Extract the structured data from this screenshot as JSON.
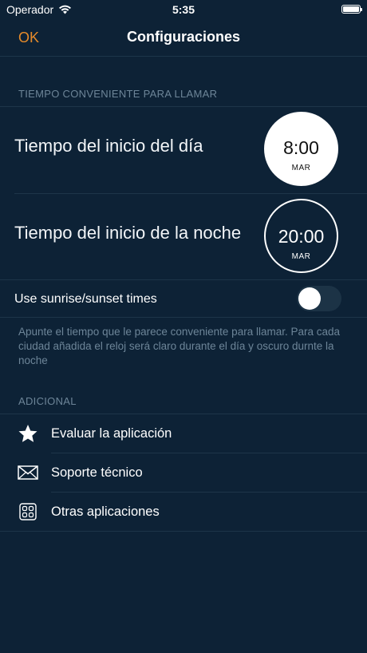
{
  "status_bar": {
    "carrier": "Operador",
    "time": "5:35"
  },
  "nav": {
    "ok_label": "OK",
    "title": "Configuraciones"
  },
  "convenient_time": {
    "header": "TIEMPO CONVENIENTE PARA LLAMAR",
    "day_label": "Tiempo del inicio del día",
    "day_time": "8:00",
    "day_weekday": "MAR",
    "night_label": "Tiempo del inicio de la noche",
    "night_time": "20:00",
    "night_weekday": "MAR",
    "sunrise_label": "Use sunrise/sunset times",
    "explanation": "Apunte el tiempo que le parece conveniente para llamar. Para cada ciudad añadida el reloj será claro durante el día y oscuro durnte la noche"
  },
  "additional": {
    "header": "ADICIONAL",
    "items": [
      {
        "label": "Evaluar la aplicación",
        "icon": "star-icon"
      },
      {
        "label": "Soporte técnico",
        "icon": "envelope-icon"
      },
      {
        "label": "Otras aplicaciones",
        "icon": "apps-grid-icon"
      }
    ]
  },
  "colors": {
    "background": "#0d2236",
    "accent": "#e58a2a",
    "muted_text": "#6d8598"
  }
}
